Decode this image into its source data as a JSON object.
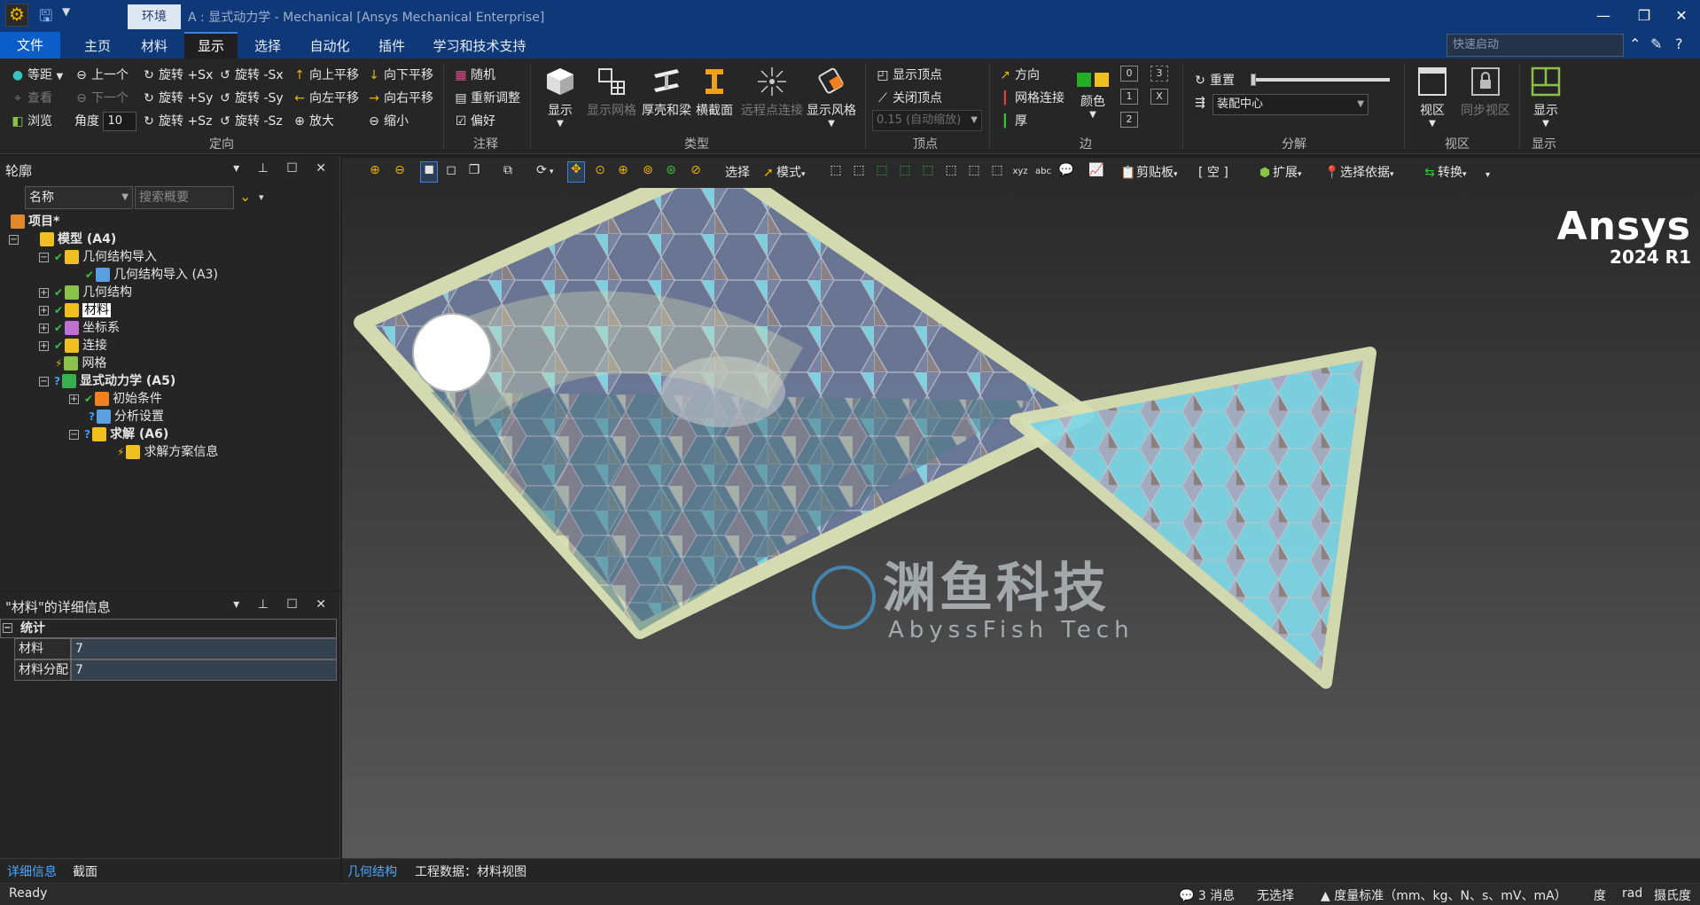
{
  "titlebar": {
    "context_tab": "环境",
    "title": "A : 显式动力学 - Mechanical [Ansys Mechanical Enterprise]",
    "minimize": "—",
    "restore": "❐",
    "close": "✕"
  },
  "tabs": {
    "file": "文件",
    "items": [
      "主页",
      "材料",
      "显示",
      "选择",
      "自动化",
      "插件",
      "学习和技术支持"
    ],
    "active": "显示",
    "quick_launch_placeholder": "快速启动"
  },
  "ribbon": {
    "orient": {
      "iso": "等距",
      "view": "查看",
      "browse": "浏览",
      "prev": "上一个",
      "next": "下一个",
      "angle_label": "角度",
      "angle_value": "10",
      "rot_px": "旋转 +Sx",
      "rot_mx": "旋转 -Sx",
      "rot_py": "旋转 +Sy",
      "rot_my": "旋转 -Sy",
      "rot_pz": "旋转 +Sz",
      "rot_mz": "旋转 -Sz",
      "pan_up": "向上平移",
      "pan_down": "向下平移",
      "pan_left": "向左平移",
      "pan_right": "向右平移",
      "zoom_in": "放大",
      "zoom_out": "缩小",
      "group": "定向"
    },
    "annot": {
      "random": "随机",
      "readjust": "重新调整",
      "prefs": "偏好",
      "group": "注释"
    },
    "type": {
      "show": "显示",
      "show_mesh": "显示网格",
      "shells": "厚壳和梁",
      "cross": "横截面",
      "remote": "远程点连接",
      "style": "显示风格",
      "group": "类型"
    },
    "vertex": {
      "show_vertex": "显示顶点",
      "close_vertex": "关闭顶点",
      "scale": "0.15 (自动缩放)",
      "group": "顶点"
    },
    "edge": {
      "direction": "方向",
      "mesh_conn": "网格连接",
      "thick": "厚",
      "color": "颜色",
      "n0": "0",
      "n1": "1",
      "n2": "2",
      "n3": "3",
      "nx": "X",
      "group": "边"
    },
    "explode": {
      "reset": "重置",
      "assembly_center": "装配中心",
      "group": "分解"
    },
    "viewgrp": {
      "view": "视区",
      "sync": "同步视区",
      "group": "视区"
    },
    "displaygrp": {
      "show": "显示",
      "group": "显示"
    }
  },
  "outline": {
    "title": "轮廓",
    "filter_name": "名称",
    "search_placeholder": "搜索概要",
    "tree": {
      "project": "项目*",
      "model": "模型 (A4)",
      "geom_import": "几何结构导入",
      "geom_import_a3": "几何结构导入 (A3)",
      "geometry": "几何结构",
      "materials": "材料",
      "coords": "坐标系",
      "connections": "连接",
      "mesh": "网格",
      "explicit": "显式动力学 (A5)",
      "initial": "初始条件",
      "analysis": "分析设置",
      "solution": "求解 (A6)",
      "solution_info": "求解方案信息"
    }
  },
  "details": {
    "title": "\"材料\"的详细信息",
    "section": "统计",
    "rows": [
      {
        "key": "材料",
        "value": "7"
      },
      {
        "key": "材料分配",
        "value": "7"
      }
    ]
  },
  "left_tabs": {
    "details": "详细信息",
    "section": "截面"
  },
  "gfx_toolbar": {
    "select": "选择",
    "mode": "模式",
    "clipboard": "剪贴板",
    "empty": "[ 空 ]",
    "extend": "扩展",
    "select_by": "选择依据",
    "convert": "转换"
  },
  "viewport": {
    "logo_name": "Ansys",
    "logo_ver": "2024 R1",
    "watermark_cn": "渊鱼科技",
    "watermark_en": "AbyssFish Tech"
  },
  "view_tabs": {
    "geometry": "几何结构",
    "project_data": "工程数据：材料视图"
  },
  "status": {
    "ready": "Ready",
    "messages": "3 消息",
    "no_selection": "无选择",
    "units": "度量标准（mm、kg、N、s、mV、mA）",
    "deg": "度",
    "rad": "rad",
    "celsius": "摄氏度"
  },
  "colors": {
    "titlebar": "#0e3877",
    "file_tab": "#0b5ec7",
    "accent": "#3b82e0",
    "mesh_cyan": "#7fd7e6",
    "mesh_slate": "#7b87a6",
    "mesh_taupe": "#8f8486",
    "mesh_olive": "#d9e0b4"
  }
}
